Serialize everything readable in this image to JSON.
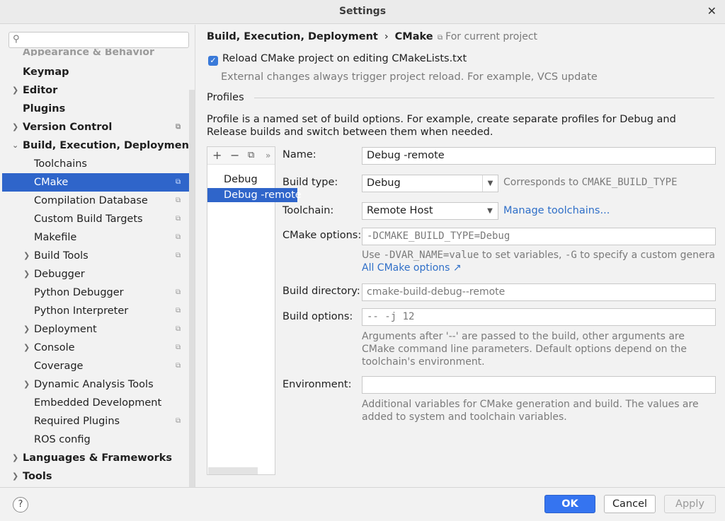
{
  "window": {
    "title": "Settings",
    "close": "✕"
  },
  "search": {
    "placeholder": ""
  },
  "sidebar": {
    "cutoff_label": "Appearance & Behavior",
    "items": [
      {
        "label": "Keymap"
      },
      {
        "label": "Editor"
      },
      {
        "label": "Plugins"
      },
      {
        "label": "Version Control"
      },
      {
        "label": "Build, Execution, Deployment"
      },
      {
        "label": "Toolchains"
      },
      {
        "label": "CMake"
      },
      {
        "label": "Compilation Database"
      },
      {
        "label": "Custom Build Targets"
      },
      {
        "label": "Makefile"
      },
      {
        "label": "Build Tools"
      },
      {
        "label": "Debugger"
      },
      {
        "label": "Python Debugger"
      },
      {
        "label": "Python Interpreter"
      },
      {
        "label": "Deployment"
      },
      {
        "label": "Console"
      },
      {
        "label": "Coverage"
      },
      {
        "label": "Dynamic Analysis Tools"
      },
      {
        "label": "Embedded Development"
      },
      {
        "label": "Required Plugins"
      },
      {
        "label": "ROS config"
      },
      {
        "label": "Languages & Frameworks"
      },
      {
        "label": "Tools"
      }
    ]
  },
  "header": {
    "crumb_parent": "Build, Execution, Deployment",
    "crumb_sep": "›",
    "crumb_current": "CMake",
    "scope": "For current project"
  },
  "reload": {
    "label": "Reload CMake project on editing CMakeLists.txt",
    "checked": true,
    "hint": "External changes always trigger project reload. For example, VCS update"
  },
  "profiles": {
    "heading": "Profiles",
    "description": "Profile is a named set of build options. For example, create separate profiles for Debug and Release builds and switch between them when needed.",
    "list": [
      "Debug",
      "Debug -remote"
    ],
    "selected": "Debug -remote"
  },
  "form": {
    "name_label": "Name:",
    "name_value": "Debug -remote",
    "build_type_label": "Build type:",
    "build_type_value": "Debug",
    "build_type_hint_prefix": "Corresponds to ",
    "build_type_hint_code": "CMAKE_BUILD_TYPE",
    "toolchain_label": "Toolchain:",
    "toolchain_value": "Remote Host",
    "manage_toolchains": "Manage toolchains...",
    "cmake_options_label": "CMake options:",
    "cmake_options_value": "-DCMAKE_BUILD_TYPE=Debug",
    "cmake_hint_1": "Use ",
    "cmake_hint_code1": "-DVAR_NAME=value",
    "cmake_hint_2": " to set variables, ",
    "cmake_hint_code2": "-G",
    "cmake_hint_3": " to specify a custom generato",
    "all_cmake_options": "All CMake options ↗",
    "build_dir_label": "Build directory:",
    "build_dir_value": "cmake-build-debug--remote",
    "build_options_label": "Build options:",
    "build_options_value": "-- -j 12",
    "build_options_hint_1": "Arguments after '--' are passed to the build, other arguments are",
    "build_options_hint_2": "CMake command line parameters. Default options depend on the",
    "build_options_hint_3": "toolchain's environment.",
    "env_label": "Environment:",
    "env_value": "",
    "env_hint_1": "Additional variables for CMake generation and build. The values are",
    "env_hint_2": "added to system and toolchain variables."
  },
  "buttons": {
    "help": "?",
    "ok": "OK",
    "cancel": "Cancel",
    "apply": "Apply"
  }
}
